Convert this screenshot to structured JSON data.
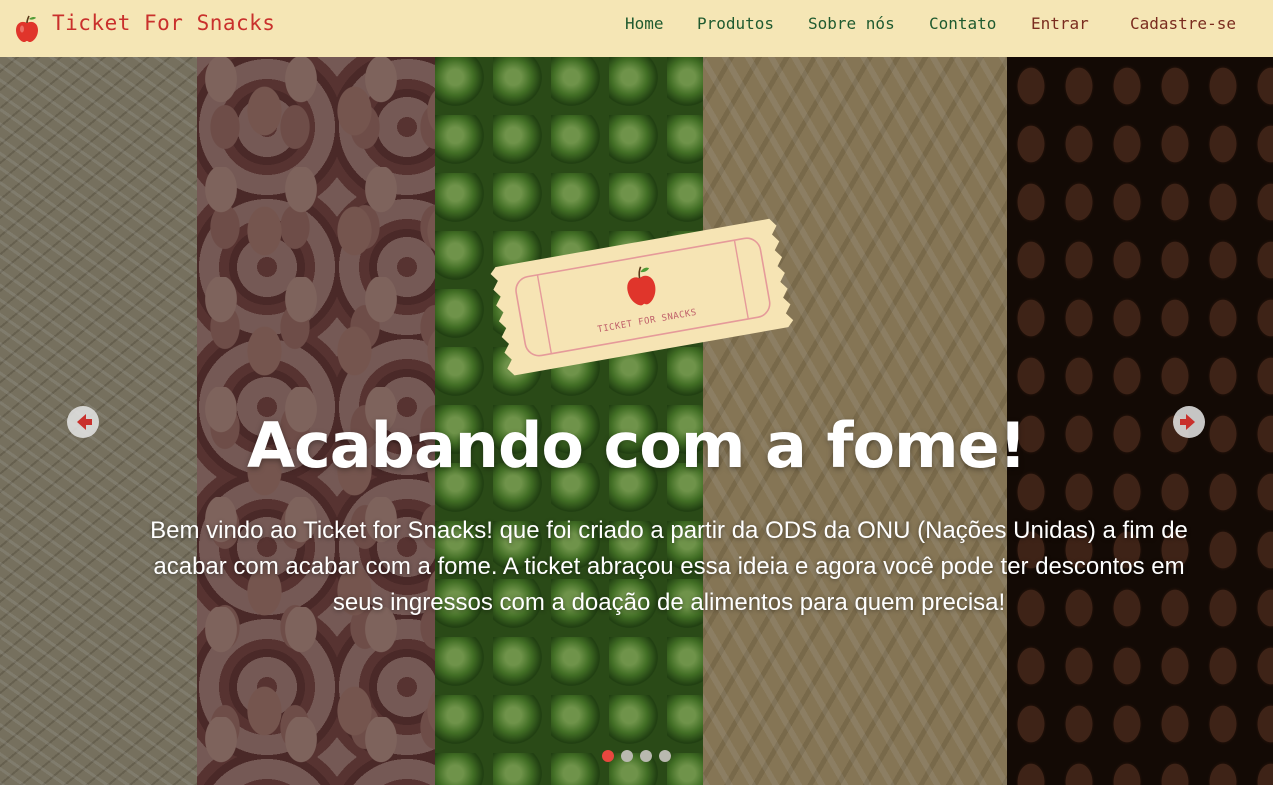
{
  "navbar": {
    "brand": "Ticket For Snacks",
    "links": [
      "Home",
      "Produtos",
      "Sobre nós",
      "Contato"
    ],
    "auth": [
      "Entrar",
      "Cadastre-se"
    ]
  },
  "hero": {
    "ticket_text": "TICKET FOR SNACKS",
    "title": "Acabando com a fome!",
    "text": "Bem vindo ao Ticket for Snacks! que foi criado a partir da ODS da ONU (Nações Unidas) a fim de acabar com acabar com a fome. A ticket abraçou essa ideia e agora você pode ter descontos em seus ingressos com a doação de alimentos para quem precisa!",
    "slides": 4,
    "active_slide": 1,
    "strips": [
      "rice",
      "beans",
      "peas",
      "pasta",
      "coffee"
    ]
  },
  "colors": {
    "navbar_bg": "#f5e6b5",
    "brand": "#c9302c",
    "nav_link": "#1f5a2f",
    "auth_link": "#7a2c1f",
    "active_dot": "#e8473f"
  }
}
